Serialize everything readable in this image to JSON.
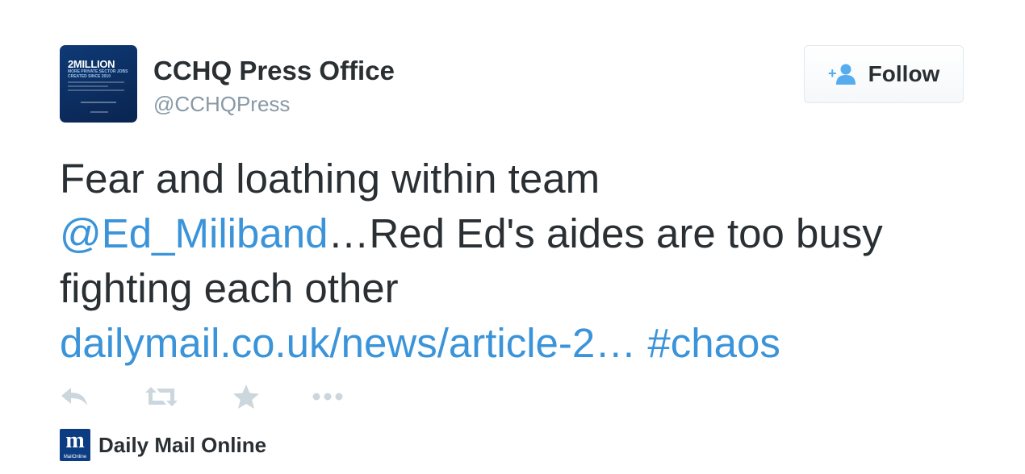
{
  "author": {
    "name": "CCHQ Press Office",
    "handle": "@CCHQPress",
    "avatar": {
      "headline": "2MILLION",
      "subline1": "MORE PRIVATE SECTOR JOBS",
      "subline2": "CREATED SINCE 2010"
    }
  },
  "follow_button": {
    "label": "Follow",
    "icon": "add-user-icon"
  },
  "tweet": {
    "line1": "Fear and loathing within team",
    "mention": "@Ed_Miliband",
    "line2_rest": "…Red Ed's aides are too busy",
    "line3": "fighting each other",
    "link": "dailymail.co.uk/news/article-2…",
    "hashtag": "#chaos"
  },
  "actions": [
    {
      "name": "reply",
      "icon": "reply-icon"
    },
    {
      "name": "retweet",
      "icon": "retweet-icon"
    },
    {
      "name": "favorite",
      "icon": "star-icon"
    },
    {
      "name": "more",
      "icon": "more-icon"
    }
  ],
  "source": {
    "logo_letter": "m",
    "logo_sub": "MailOnline",
    "name": "Daily Mail Online"
  },
  "colors": {
    "link": "#3b94d9",
    "text": "#292f33",
    "muted": "#8899a6",
    "icon": "#ccd6dd",
    "follow_icon": "#55acee",
    "avatar_bg": "#0e3a75",
    "source_logo_bg": "#0c3c82"
  }
}
